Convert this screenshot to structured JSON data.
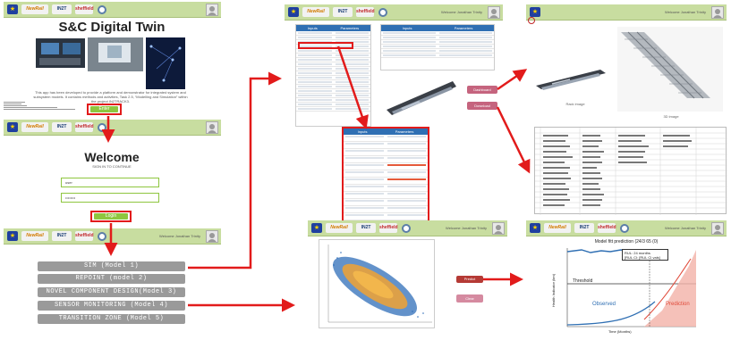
{
  "app": {
    "title": "S&C Digital Twin",
    "description": "This app has been developed to provide a platform and demonstrator for integrated system and subsystem models. It contains methods and activities, Task 2.5, “Modelling and Simulation” within the project IN2TRACK3.",
    "enter_label": "Enter"
  },
  "header": {
    "logo_text": [
      "NewRail",
      "IN2T",
      "sheffield"
    ],
    "user_title": "Welcome Jonathan Trinity",
    "bar_title_short": "Welcome Jonathan Trinity"
  },
  "login": {
    "welcome": "Welcome",
    "subtitle": "SIGN IN TO CONTINUE",
    "username_value": "user",
    "password_value": "••••••••",
    "login_label": "Login"
  },
  "menu": {
    "items": [
      "SIM (Model 1)",
      "REPOINT (model 2)",
      "NOVEL COMPONENT DESIGN(Model 3)",
      "SENSOR MONITORING (Model 4)",
      "TRANSITION ZONE (Model 5)"
    ]
  },
  "sim": {
    "parameters_header": "Parameters",
    "inputs_header": "Inputs",
    "dashboard_label": "Dashboard",
    "download_label": "Download",
    "image_caption": "Rack image",
    "image2_caption": "3D image"
  },
  "sensor": {
    "predict_label": "Predict",
    "clear_label": "Clear"
  },
  "prediction": {
    "chart_title": "Model fitt prediction (24/3 65 (0)",
    "annotation_line1": "RUL: 24 months",
    "annotation_line2": "[RUL CI: [RUL CI vals]",
    "threshold_label": "Threshold",
    "observed_label": "Observed",
    "prediction_label": "Prediction",
    "xlabel": "Time (Months)",
    "ylabel": "Health Indicator (km)"
  },
  "colors": {
    "bar_green": "#c8dda0",
    "accent_red": "#e21b1b",
    "button_green": "#8ec63f",
    "menu_grey": "#9a9a9a",
    "table_blue": "#2f6fb3"
  }
}
